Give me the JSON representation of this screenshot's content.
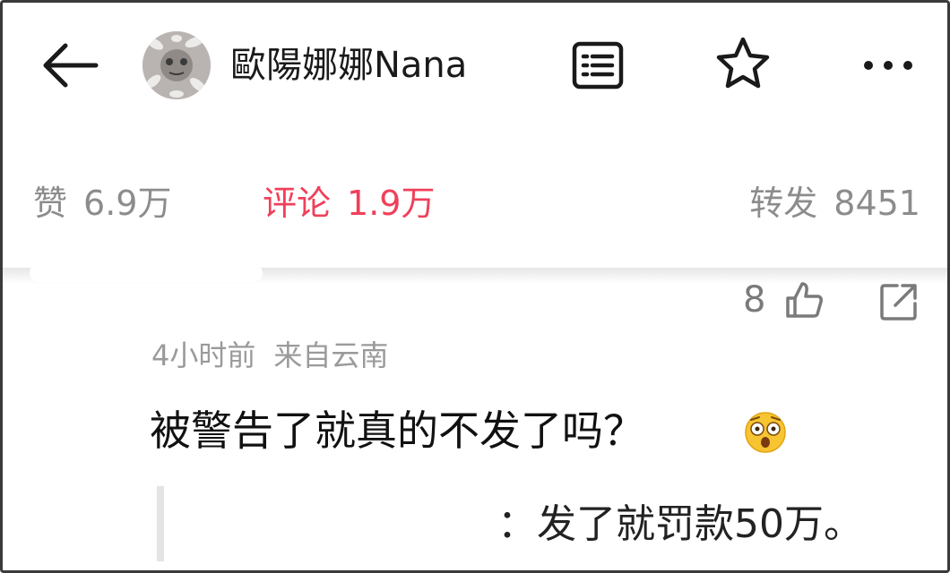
{
  "header": {
    "username": "歐陽娜娜Nana",
    "icons": [
      "back-arrow-icon",
      "avatar",
      "document-icon",
      "star-icon",
      "more-icon"
    ]
  },
  "stats": {
    "like_label": "赞",
    "like_count": "6.9万",
    "comment_label": "评论",
    "comment_count": "1.9万",
    "repost_label": "转发",
    "repost_count": "8451",
    "active_color": "#f0405a"
  },
  "comment": {
    "like_count": "8",
    "time": "4小时前",
    "location": "来自云南",
    "text": "被警告了就真的不发了吗？",
    "emoji": "shocked-face-icon",
    "quote": "：发了就罚款50万。"
  }
}
